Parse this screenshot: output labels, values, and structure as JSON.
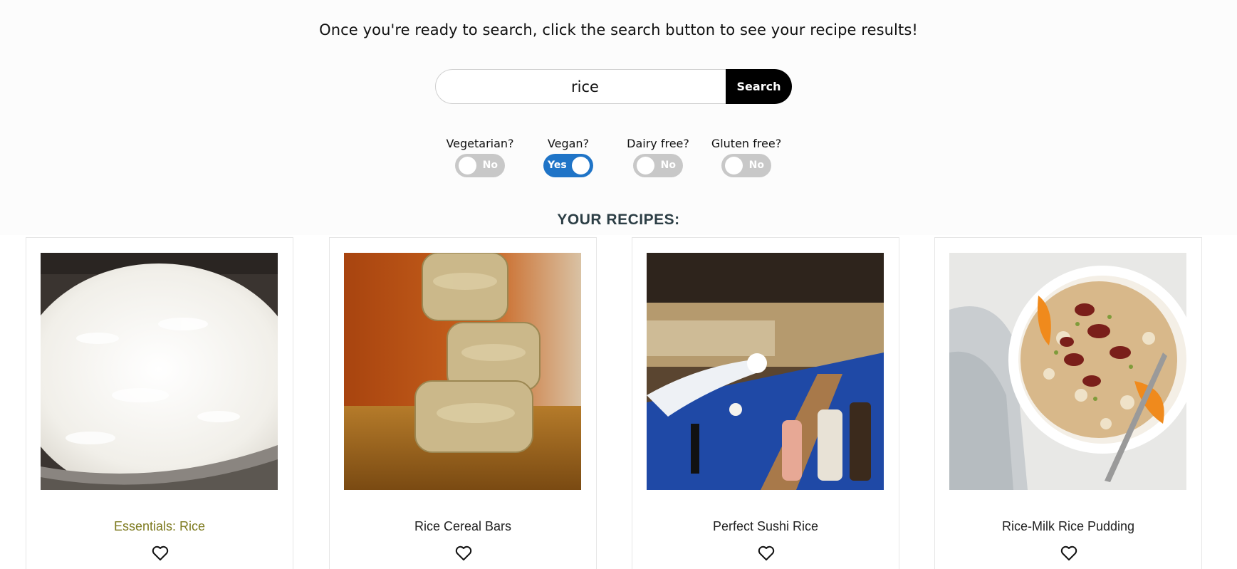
{
  "instructions": "Once you're ready to search, click the search button to see your recipe results!",
  "search": {
    "value": "rice",
    "button_label": "Search"
  },
  "filters": [
    {
      "label": "Vegetarian?",
      "state": "No",
      "on": false
    },
    {
      "label": "Vegan?",
      "state": "Yes",
      "on": true
    },
    {
      "label": "Dairy free?",
      "state": "No",
      "on": false
    },
    {
      "label": "Gluten free?",
      "state": "No",
      "on": false
    }
  ],
  "section_heading": "YOUR RECIPES:",
  "recipes": [
    {
      "title": "Essentials: Rice",
      "image": "white-rice-in-pot"
    },
    {
      "title": "Rice Cereal Bars",
      "image": "stacked-rice-cereal-bars"
    },
    {
      "title": "Perfect Sushi Rice",
      "image": "hand-holding-sushi-rice-ball"
    },
    {
      "title": "Rice-Milk Rice Pudding",
      "image": "rice-pudding-bowl-with-oranges"
    }
  ],
  "colors": {
    "accent_toggle": "#1f74c7",
    "highlight_title": "#7d7a1f",
    "heading": "#2c3e45"
  }
}
